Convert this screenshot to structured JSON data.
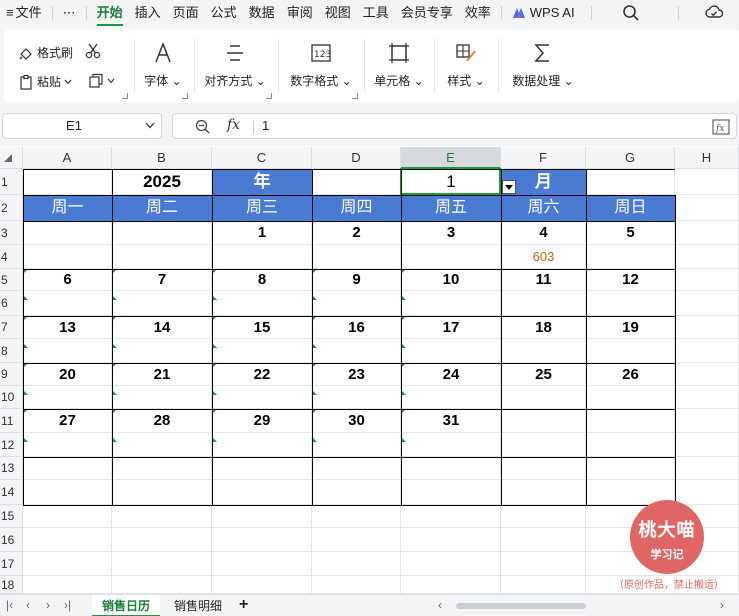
{
  "menu": {
    "hamburger_icon": "≡",
    "file": "文件",
    "more": "⋯",
    "tabs": [
      "开始",
      "插入",
      "页面",
      "公式",
      "数据",
      "审阅",
      "视图",
      "工具",
      "会员专享",
      "效率"
    ],
    "ai_label": "WPS AI"
  },
  "ribbon": {
    "format_painter": "格式刷",
    "paste": "粘贴",
    "font": "字体",
    "align": "对齐方式",
    "number_format": "数字格式",
    "cell": "单元格",
    "style": "样式",
    "data_processing": "数据处理"
  },
  "formula_bar": {
    "name_box": "E1",
    "fx": "fx",
    "value": "1"
  },
  "columns": [
    "A",
    "B",
    "C",
    "D",
    "E",
    "F",
    "G",
    "H"
  ],
  "rows": [
    "1",
    "2",
    "3",
    "4",
    "5",
    "6",
    "7",
    "8",
    "9",
    "10",
    "11",
    "12",
    "13",
    "14",
    "15",
    "16",
    "17",
    "18"
  ],
  "calendar": {
    "year": "2025",
    "year_label": "年",
    "month": "1",
    "month_label": "月",
    "weekdays": [
      "周一",
      "周二",
      "周三",
      "周四",
      "周五",
      "周六",
      "周日"
    ],
    "weeks": [
      [
        "",
        "",
        "1",
        "2",
        "3",
        "4",
        "5"
      ],
      [
        "6",
        "7",
        "8",
        "9",
        "10",
        "11",
        "12"
      ],
      [
        "13",
        "14",
        "15",
        "16",
        "17",
        "18",
        "19"
      ],
      [
        "20",
        "21",
        "22",
        "23",
        "24",
        "25",
        "26"
      ],
      [
        "27",
        "28",
        "29",
        "30",
        "31",
        "",
        ""
      ]
    ],
    "note": "603"
  },
  "watermark": {
    "name": "桃大喵",
    "sub": "学习记",
    "note": "（原创作品，禁止搬运）"
  },
  "sheets": [
    "销售日历",
    "销售明细"
  ],
  "colors": {
    "accent": "#1a9a3c",
    "header_blue": "#4a7bd3",
    "lunar": "#c0641d",
    "watermark": "#e06666"
  }
}
